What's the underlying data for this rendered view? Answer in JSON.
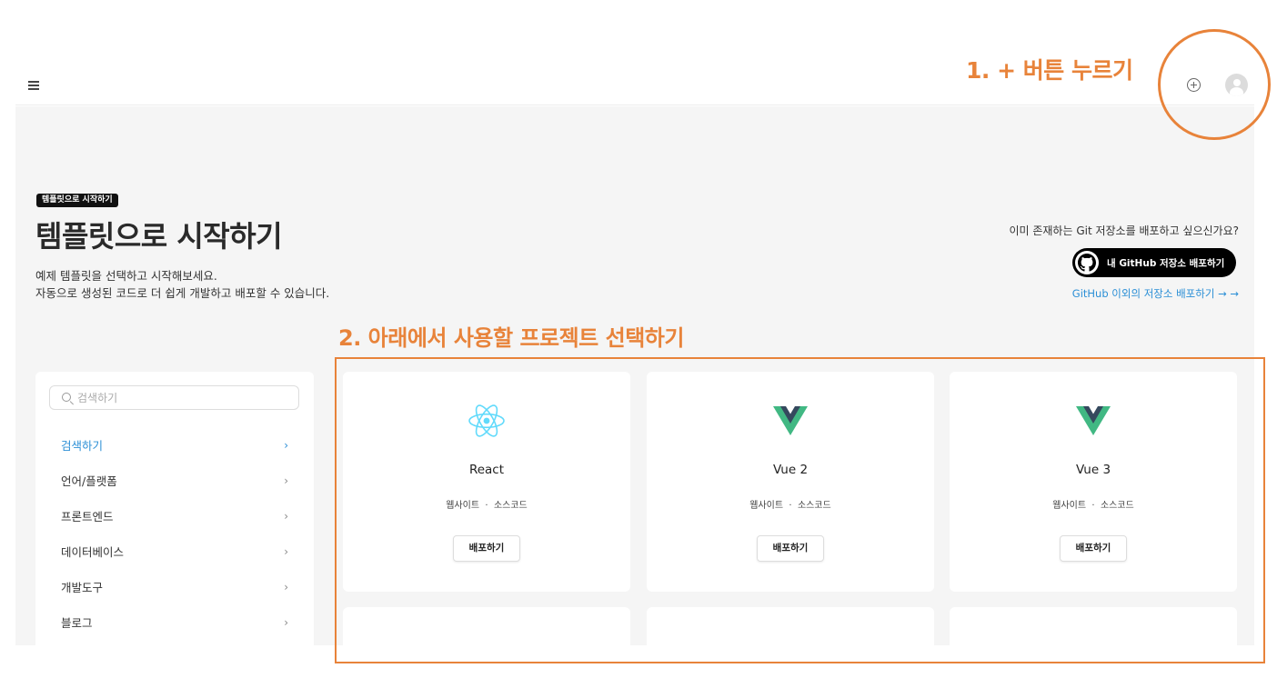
{
  "annotations": {
    "step1": "1. + 버튼 누르기",
    "step2": "2. 아래에서 사용할 프로젝트 선택하기",
    "color": "#e8833a"
  },
  "header": {
    "menu_icon": "hamburger-icon",
    "add_icon": "plus-circle-icon",
    "avatar_icon": "user-avatar-icon"
  },
  "page": {
    "badge": "템플릿으로 시작하기",
    "title": "템플릿으로 시작하기",
    "desc_line1": "예제 템플릿을 선택하고 시작해보세요.",
    "desc_line2": "자동으로 생성된 코드로 더 쉽게 개발하고 배포할 수 있습니다."
  },
  "existing": {
    "question": "이미 존재하는 Git 저장소를 배포하고 싶으신가요?",
    "github_button": "내 GitHub 저장소 배포하기",
    "other_link": "GitHub 이외의 저장소 배포하기 → →"
  },
  "sidebar": {
    "search_placeholder": "검색하기",
    "items": [
      {
        "label": "검색하기",
        "active": true
      },
      {
        "label": "언어/플랫폼"
      },
      {
        "label": "프론트엔드"
      },
      {
        "label": "데이터베이스"
      },
      {
        "label": "개발도구"
      },
      {
        "label": "블로그"
      }
    ],
    "chevron": "›"
  },
  "cards": [
    {
      "name": "React",
      "tag1": "웹사이트",
      "sep": "·",
      "tag2": "소스코드",
      "button": "배포하기",
      "icon": "react-icon"
    },
    {
      "name": "Vue 2",
      "tag1": "웹사이트",
      "sep": "·",
      "tag2": "소스코드",
      "button": "배포하기",
      "icon": "vue-icon"
    },
    {
      "name": "Vue 3",
      "tag1": "웹사이트",
      "sep": "·",
      "tag2": "소스코드",
      "button": "배포하기",
      "icon": "vue-icon"
    }
  ],
  "colors": {
    "accent_blue": "#2b8fd6",
    "react": "#61dafb",
    "vue_green": "#41b883",
    "vue_dark": "#35495e"
  }
}
